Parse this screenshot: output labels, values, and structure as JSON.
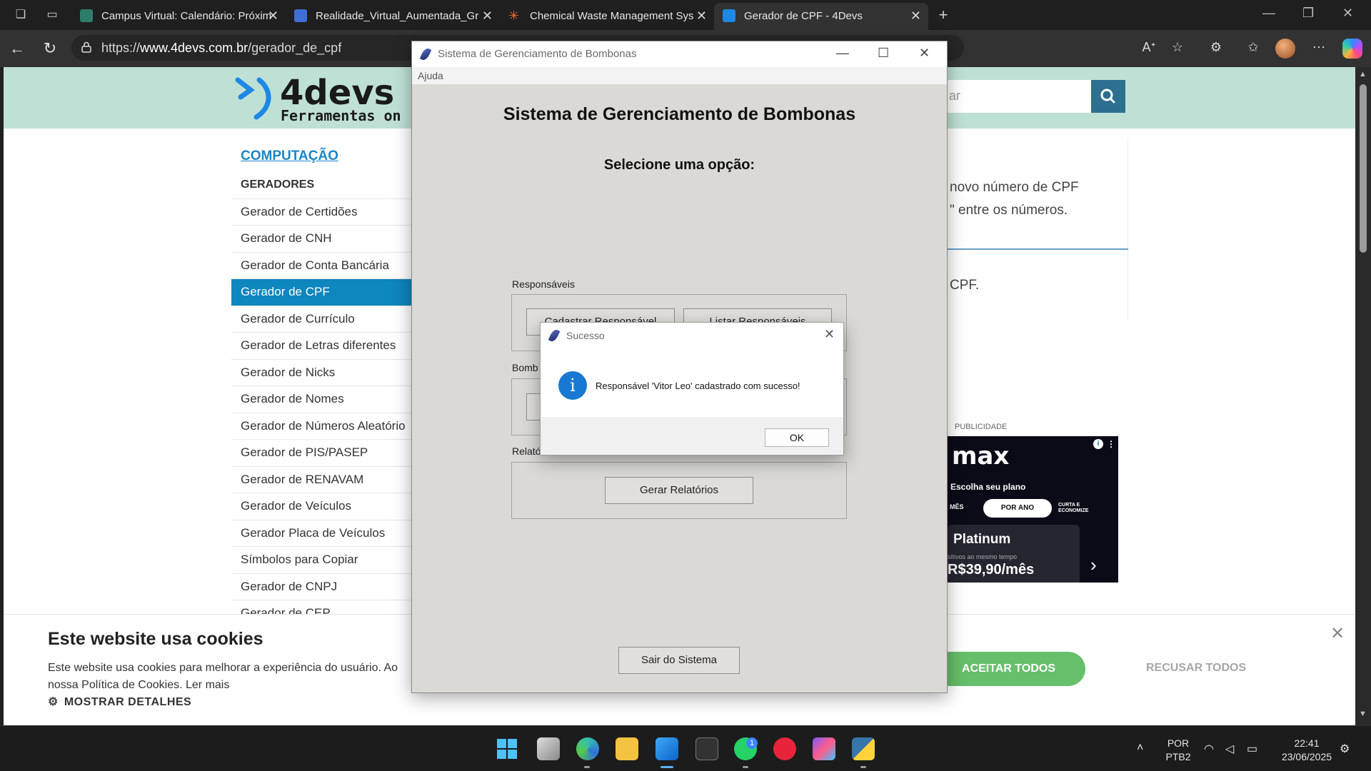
{
  "browser": {
    "tabs": [
      {
        "title": "Campus Virtual: Calendário: Próxim",
        "active": false
      },
      {
        "title": "Realidade_Virtual_Aumentada_Gr",
        "active": false
      },
      {
        "title": "Chemical Waste Management Sys",
        "active": false
      },
      {
        "title": "Gerador de CPF - 4Devs",
        "active": true
      }
    ],
    "url_scheme": "https://",
    "url_host": "www.4devs.com.br",
    "url_path": "/gerador_de_cpf"
  },
  "website": {
    "logo": "4devs",
    "logo_sub": "Ferramentas on",
    "search_placeholder": "ar",
    "category": "COMPUTAÇÃO",
    "menu_header": "GERADORES",
    "menu_items": [
      "Gerador de Certidões",
      "Gerador de CNH",
      "Gerador de Conta Bancária",
      "Gerador de CPF",
      "Gerador de Currículo",
      "Gerador de Letras diferentes",
      "Gerador de Nicks",
      "Gerador de Nomes",
      "Gerador de Números Aleatório",
      "Gerador de PIS/PASEP",
      "Gerador de RENAVAM",
      "Gerador de Veículos",
      "Gerador Placa de Veículos",
      "Símbolos para Copiar",
      "Gerador de CNPJ",
      "Gerador de CEP"
    ],
    "active_item": "Gerador de CPF",
    "content_line1": "novo número de CPF",
    "content_line2": "\" entre os números.",
    "content_line3": "CPF.",
    "ad": {
      "label": "PUBLICIDADE",
      "brand": "max",
      "choose_plan": "Escolha seu plano",
      "per_month": "MÊS",
      "per_year": "POR ANO",
      "save": "CURTA E ECONOMIZE",
      "plan_name": "Platinum",
      "devices": "sitivos ao mesmo tempo",
      "price": "R$39,90/mês"
    },
    "cookie": {
      "title": "Este website usa cookies",
      "text_line1": "Este website usa cookies para melhorar a experiência do usuário. Ao",
      "text_line2": "nossa Política de Cookies. Ler mais",
      "details": "MOSTRAR DETALHES",
      "accept": "ACEITAR TODOS",
      "refuse": "RECUSAR TODOS"
    }
  },
  "app": {
    "window_title": "Sistema de Gerenciamento de Bombonas",
    "menu": "Ajuda",
    "heading": "Sistema de Gerenciamento de Bombonas",
    "subheading": "Selecione uma opção:",
    "group1_label": "Responsáveis",
    "group1_btn1": "Cadastrar Responsável",
    "group1_btn2": "Listar Responsáveis",
    "group2_label": "Bomb",
    "group3_label": "Relató",
    "reports_button": "Gerar Relatórios",
    "exit_button": "Sair do Sistema"
  },
  "dialog": {
    "title": "Sucesso",
    "message": "Responsável 'Vitor Leo' cadastrado com sucesso!",
    "ok": "OK"
  },
  "taskbar": {
    "lang_line1": "POR",
    "lang_line2": "PTB2",
    "time": "22:41",
    "date": "23/06/2025",
    "whatsapp_badge": "1"
  }
}
